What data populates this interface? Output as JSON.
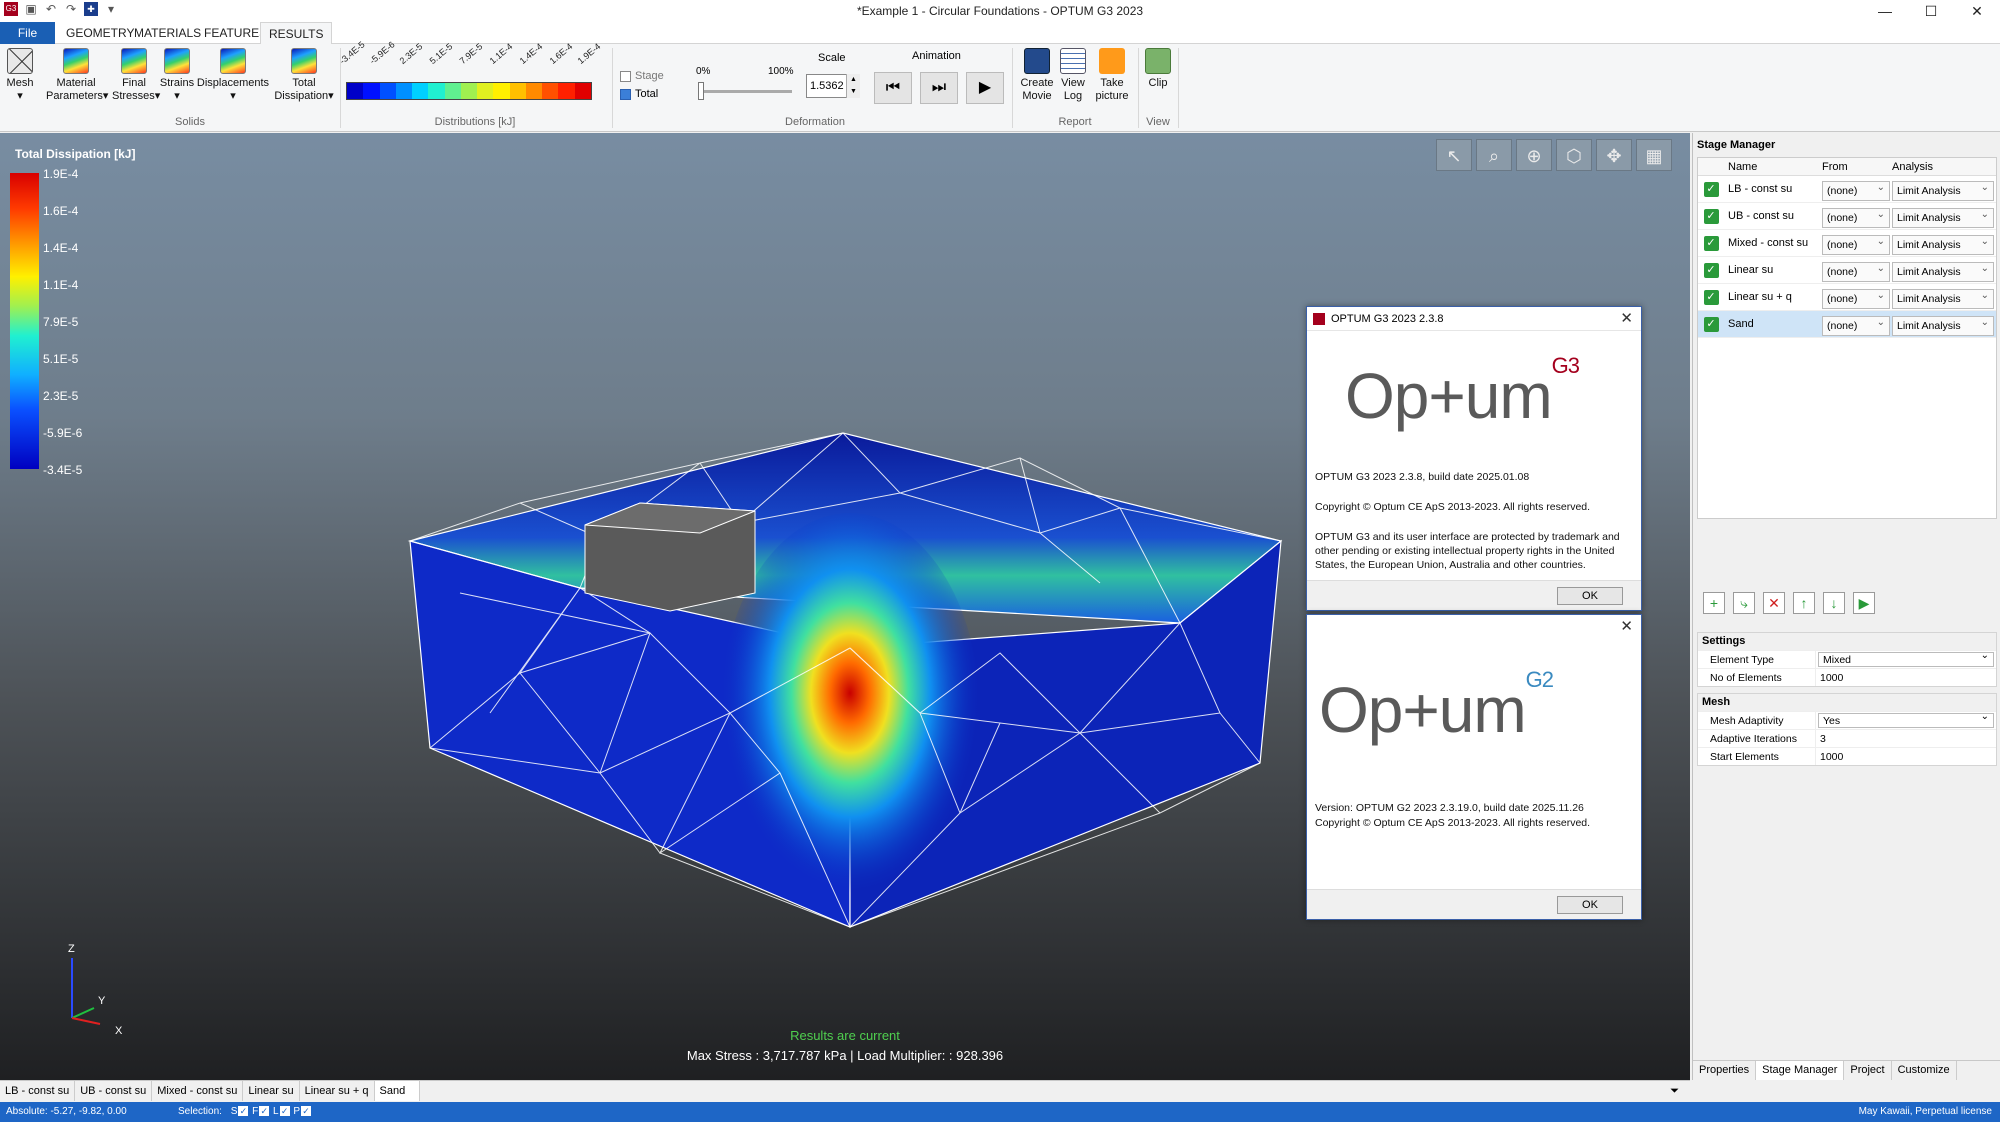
{
  "window": {
    "title": "*Example 1 - Circular Foundations - OPTUM G3 2023",
    "minimize": "—",
    "maximize": "☐",
    "close": "✕"
  },
  "menu_tabs": [
    {
      "label": "File"
    },
    {
      "label": "GEOMETRY"
    },
    {
      "label": "MATERIALS"
    },
    {
      "label": "FEATURES"
    },
    {
      "label": "RESULTS"
    }
  ],
  "ribbon": {
    "mesh": "Mesh",
    "material_parameters": "Material Parameters",
    "final_stresses": "Final Stresses",
    "strains": "Strains",
    "displacements": "Displacements",
    "total_dissipation": "Total Dissipation",
    "group_solids": "Solids",
    "colorbar_ticks": [
      "-3.4E-5",
      "-5.9E-6",
      "2.3E-5",
      "5.1E-5",
      "7.9E-5",
      "1.1E-4",
      "1.4E-4",
      "1.6E-4",
      "1.9E-4"
    ],
    "group_distributions": "Distributions [kJ]",
    "stage": "Stage",
    "total": "Total",
    "pct0": "0%",
    "pct100": "100%",
    "scale_label": "Scale",
    "scale_value": "1.5362",
    "animation_label": "Animation",
    "group_deformation": "Deformation",
    "create_movie": "Create Movie",
    "view_log": "View Log",
    "take_picture": "Take picture",
    "group_report": "Report",
    "clip": "Clip",
    "group_view": "View"
  },
  "colors": {
    "accent": "#1a5fb4",
    "status_green": "#4fcf4f",
    "brand_red": "#a4001d"
  },
  "legend": {
    "title": "Total Dissipation [kJ]",
    "labels": [
      "1.9E-4",
      "1.6E-4",
      "1.4E-4",
      "1.1E-4",
      "7.9E-5",
      "5.1E-5",
      "2.3E-5",
      "-5.9E-6",
      "-3.4E-5"
    ]
  },
  "viewport": {
    "axis_z": "Z",
    "axis_y": "Y",
    "axis_x": "X",
    "status": "Results are current",
    "stress": "Max Stress : 3,717.787 kPa | Load Multiplier:  : 928.396"
  },
  "dialog_g3": {
    "title": "OPTUM G3 2023 2.3.8",
    "logo_text": "Op+um",
    "logo_sup": "G3",
    "line1": "OPTUM G3 2023 2.3.8, build date 2025.01.08",
    "line2": "Copyright © Optum CE ApS 2013-2023. All rights reserved.",
    "line3": "OPTUM G3 and its user interface are protected by trademark and other pending or existing intellectual property rights in the United States, the European Union, Australia and other countries.",
    "ok": "OK"
  },
  "dialog_g2": {
    "logo_text": "Op+um",
    "logo_sup": "G2",
    "line1": "Version: OPTUM G2 2023 2.3.19.0, build date 2025.11.26",
    "line2": "Copyright © Optum CE ApS 2013-2023. All rights reserved.",
    "ok": "OK"
  },
  "stage_manager": {
    "title": "Stage Manager",
    "columns": [
      "Name",
      "From",
      "Analysis"
    ],
    "rows": [
      {
        "name": "LB - const su",
        "from": "(none)",
        "analysis": "Limit Analysis"
      },
      {
        "name": "UB - const su",
        "from": "(none)",
        "analysis": "Limit Analysis"
      },
      {
        "name": "Mixed - const su",
        "from": "(none)",
        "analysis": "Limit Analysis"
      },
      {
        "name": "Linear su",
        "from": "(none)",
        "analysis": "Limit Analysis"
      },
      {
        "name": "Linear su + q",
        "from": "(none)",
        "analysis": "Limit Analysis"
      },
      {
        "name": "Sand",
        "from": "(none)",
        "analysis": "Limit Analysis"
      }
    ]
  },
  "settings": {
    "title": "Settings",
    "element_type_label": "Element Type",
    "element_type_value": "Mixed",
    "no_elements_label": "No of Elements",
    "no_elements_value": "1000"
  },
  "mesh": {
    "title": "Mesh",
    "adaptivity_label": "Mesh Adaptivity",
    "adaptivity_value": "Yes",
    "iterations_label": "Adaptive Iterations",
    "iterations_value": "3",
    "start_label": "Start Elements",
    "start_value": "1000"
  },
  "right_tabs": [
    "Properties",
    "Stage Manager",
    "Project",
    "Customize"
  ],
  "stage_tabs": [
    "LB - const su",
    "UB - const su",
    "Mixed - const su",
    "Linear su",
    "Linear su + q",
    "Sand"
  ],
  "statusbar": {
    "absolute": "Absolute:  -5.27, -9.82, 0.00",
    "selection": "Selection:",
    "sel_s": "S",
    "sel_f": "F",
    "sel_l": "L",
    "sel_p": "P",
    "license": "May Kawaii, Perpetual license"
  }
}
